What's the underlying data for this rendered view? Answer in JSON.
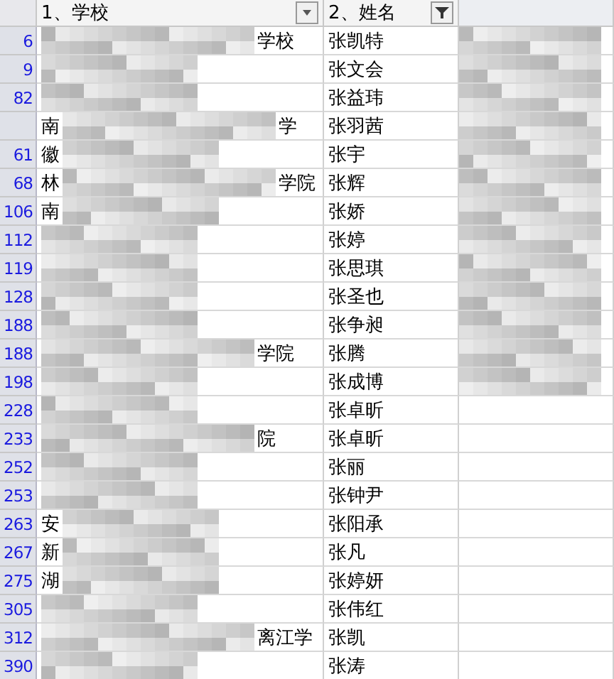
{
  "columns": [
    {
      "label": "1、学校",
      "filter": false
    },
    {
      "label": "2、姓名",
      "filter": true
    }
  ],
  "rows": [
    {
      "number": "6",
      "school": "学校",
      "name": "张凯特"
    },
    {
      "number": "9",
      "name": "张文会"
    },
    {
      "number": "82",
      "name": "张益玮"
    },
    {
      "lead": "南",
      "school": "学",
      "name": "张羽茜"
    },
    {
      "number": "61",
      "lead": "徽",
      "name": "张宇"
    },
    {
      "number": "68",
      "lead": "林",
      "school": "学院",
      "name": "张辉"
    },
    {
      "number": "106",
      "lead": "南",
      "name": "张娇"
    },
    {
      "number": "112",
      "name": "张婷"
    },
    {
      "number": "119",
      "name": "张思琪"
    },
    {
      "number": "128",
      "name": "张圣也"
    },
    {
      "number": "188",
      "name": "张争昶"
    },
    {
      "number": "188",
      "school": "学院",
      "name": "张腾"
    },
    {
      "number": "198",
      "name": "张成博"
    },
    {
      "number": "228",
      "name": "张卓昕"
    },
    {
      "number": "233",
      "school": "院",
      "name": "张卓昕"
    },
    {
      "number": "252",
      "name": "张丽"
    },
    {
      "number": "253",
      "name": "张钟尹"
    },
    {
      "number": "263",
      "lead": "安",
      "name": "张阳承"
    },
    {
      "number": "267",
      "lead": "新",
      "name": "张凡"
    },
    {
      "number": "275",
      "lead": "湖",
      "name": "张婷妍"
    },
    {
      "number": "305",
      "name": "张伟红"
    },
    {
      "number": "312",
      "school": "离江学",
      "name": "张凯"
    },
    {
      "number": "390",
      "name": "张涛"
    }
  ]
}
